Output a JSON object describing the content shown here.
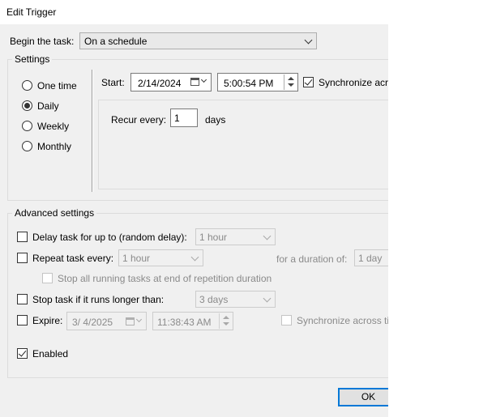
{
  "window": {
    "title": "Edit Trigger"
  },
  "begin_task": {
    "label": "Begin the task:",
    "value": "On a schedule"
  },
  "settings": {
    "title": "Settings",
    "options": [
      {
        "label": "One time",
        "selected": false
      },
      {
        "label": "Daily",
        "selected": true
      },
      {
        "label": "Weekly",
        "selected": false
      },
      {
        "label": "Monthly",
        "selected": false
      }
    ],
    "start_label": "Start:",
    "start_date": "2/14/2024",
    "start_time": "5:00:54 PM",
    "synchronize_label": "Synchronize acro",
    "synchronize_checked": true,
    "recur_label": "Recur every:",
    "recur_value": "1",
    "recur_unit": "days"
  },
  "advanced": {
    "title": "Advanced settings",
    "delay": {
      "label": "Delay task for up to (random delay):",
      "value": "1 hour",
      "checked": false
    },
    "repeat": {
      "label": "Repeat task every:",
      "value": "1 hour",
      "checked": false,
      "duration_label": "for a duration of:",
      "duration_value": "1 day"
    },
    "stop_all": {
      "label": "Stop all running tasks at end of repetition duration",
      "checked": false
    },
    "stop_longer": {
      "label": "Stop task if it runs longer than:",
      "value": "3 days",
      "checked": false
    },
    "expire": {
      "label": "Expire:",
      "date": "3/  4/2025",
      "time": "11:38:43 AM",
      "checked": false,
      "sync_label": "Synchronize across tin"
    },
    "enabled": {
      "label": "Enabled",
      "checked": true
    }
  },
  "buttons": {
    "ok": "OK"
  }
}
